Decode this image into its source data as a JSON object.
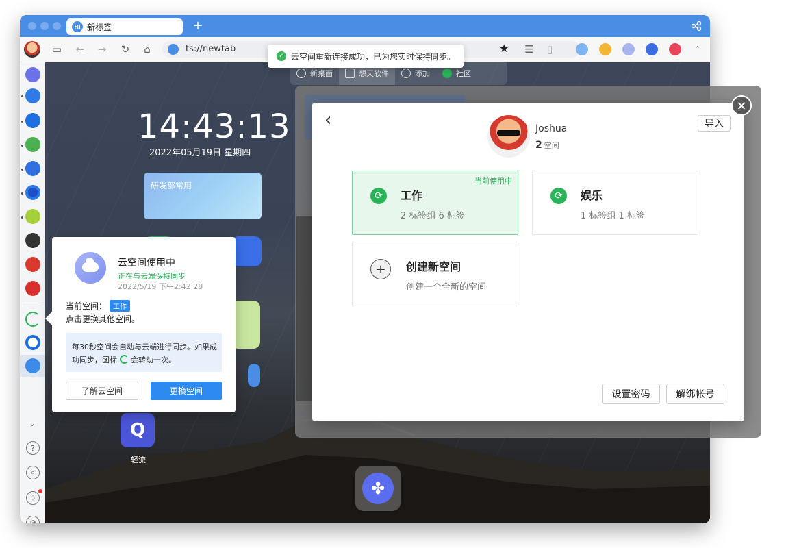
{
  "browser": {
    "tab_title": "新标签",
    "new_tab_symbol": "+",
    "url": "ts://newtab"
  },
  "toast": {
    "message": "云空间重新连接成功，已为您实时保持同步。"
  },
  "ntp": {
    "nav": [
      {
        "label": "新桌面",
        "icon": "lightbulb-icon"
      },
      {
        "label": "想天软件",
        "icon": "home-icon"
      },
      {
        "label": "添加",
        "icon": "plus-icon"
      },
      {
        "label": "社区",
        "icon": "community-icon"
      }
    ],
    "clock": "14:43:13",
    "date": "2022年05月19日 星期四",
    "widget_title": "研发部常用",
    "app_label_qingliu": "轻流"
  },
  "space_modal": {
    "user_name": "Joshua",
    "space_count": "2",
    "space_unit": "空间",
    "import_label": "导入",
    "spaces": [
      {
        "name": "工作",
        "desc": "2 标签组 6 标签",
        "badge": "当前使用中"
      },
      {
        "name": "娱乐",
        "desc": "1 标签组 1 标签"
      }
    ],
    "create": {
      "title": "创建新空间",
      "desc": "创建一个全新的空间"
    },
    "set_password_label": "设置密码",
    "unbind_label": "解绑帐号"
  },
  "cloud_popover": {
    "title": "云空间使用中",
    "status": "正在与云端保持同步",
    "time": "2022/5/19 下午2:42:28",
    "current_space_label": "当前空间：",
    "current_space_badge": "工作",
    "switch_hint": "点击更换其他空间。",
    "info_part1": "每30秒空间会自动与云端进行同步。如果成功同步，图标",
    "info_part2": "会转动一次。",
    "learn_label": "了解云空间",
    "change_label": "更换空间"
  },
  "colors": {
    "titlebar": "#4a8de5",
    "accent_green": "#2bb35a",
    "primary_blue": "#2c8af0"
  }
}
